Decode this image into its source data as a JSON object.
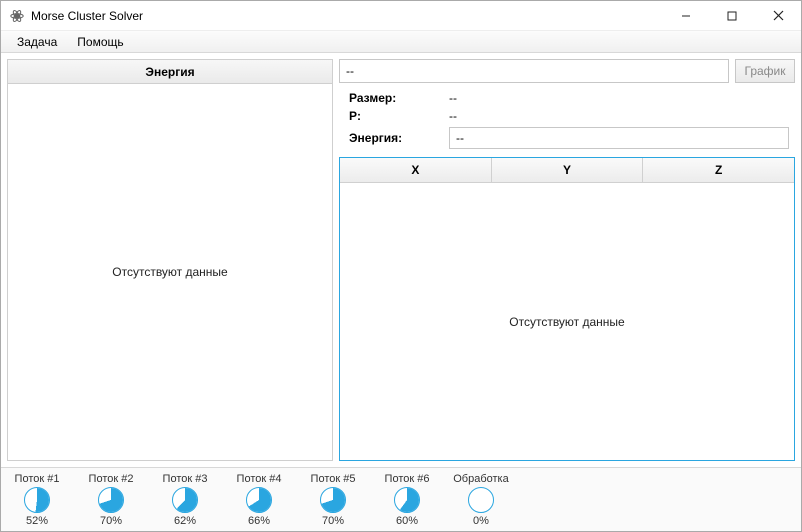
{
  "window": {
    "title": "Morse Cluster Solver"
  },
  "menubar": {
    "items": [
      "Задача",
      "Помощь"
    ]
  },
  "left_panel": {
    "header": "Энергия",
    "empty_text": "Отсутствуют данные"
  },
  "right_panel": {
    "search_value": "--",
    "graph_btn": "График",
    "size_label": "Размер:",
    "size_value": "--",
    "p_label": "P:",
    "p_value": "--",
    "energy_label": "Энергия:",
    "energy_value": "--",
    "columns": [
      "X",
      "Y",
      "Z"
    ],
    "empty_text": "Отсутствуют данные"
  },
  "threads": [
    {
      "name": "Поток #1",
      "percent": 52
    },
    {
      "name": "Поток #2",
      "percent": 70
    },
    {
      "name": "Поток #3",
      "percent": 62
    },
    {
      "name": "Поток #4",
      "percent": 66
    },
    {
      "name": "Поток #5",
      "percent": 70
    },
    {
      "name": "Поток #6",
      "percent": 60
    },
    {
      "name": "Обработка",
      "percent": 0
    }
  ],
  "colors": {
    "accent": "#2aa6e0"
  }
}
